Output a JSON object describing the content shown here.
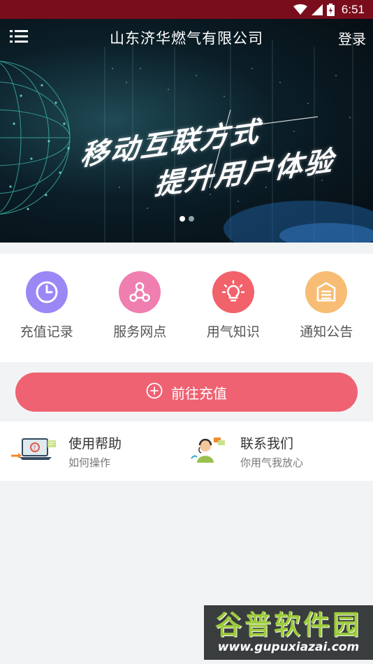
{
  "status_bar": {
    "time": "6:51",
    "bg_color": "#7a0d1c"
  },
  "header": {
    "title": "山东济华燃气有限公司",
    "login_label": "登录",
    "menu_icon": "list-menu-icon"
  },
  "banner": {
    "slogan_line1": "移动互联方式",
    "slogan_line2": "提升用户体验",
    "page_count": 2,
    "active_page": 1
  },
  "quick_menu": [
    {
      "label": "充值记录",
      "icon": "clock-icon",
      "color": "#9b87f5"
    },
    {
      "label": "服务网点",
      "icon": "network-nodes-icon",
      "color": "#ef7fb0"
    },
    {
      "label": "用气知识",
      "icon": "lightbulb-icon",
      "color": "#f1626b"
    },
    {
      "label": "通知公告",
      "icon": "notice-board-icon",
      "color": "#f7bd74"
    }
  ],
  "recharge": {
    "label": "前往充值",
    "icon": "plus-circle-icon",
    "color": "#ee6272"
  },
  "info": {
    "help": {
      "title": "使用帮助",
      "subtitle": "如何操作",
      "icon": "laptop-help-icon"
    },
    "contact": {
      "title": "联系我们",
      "subtitle": "你用气我放心",
      "icon": "customer-service-icon"
    }
  },
  "watermark": {
    "main": "谷普软件园",
    "url": "www.gupuxiazai.com"
  }
}
